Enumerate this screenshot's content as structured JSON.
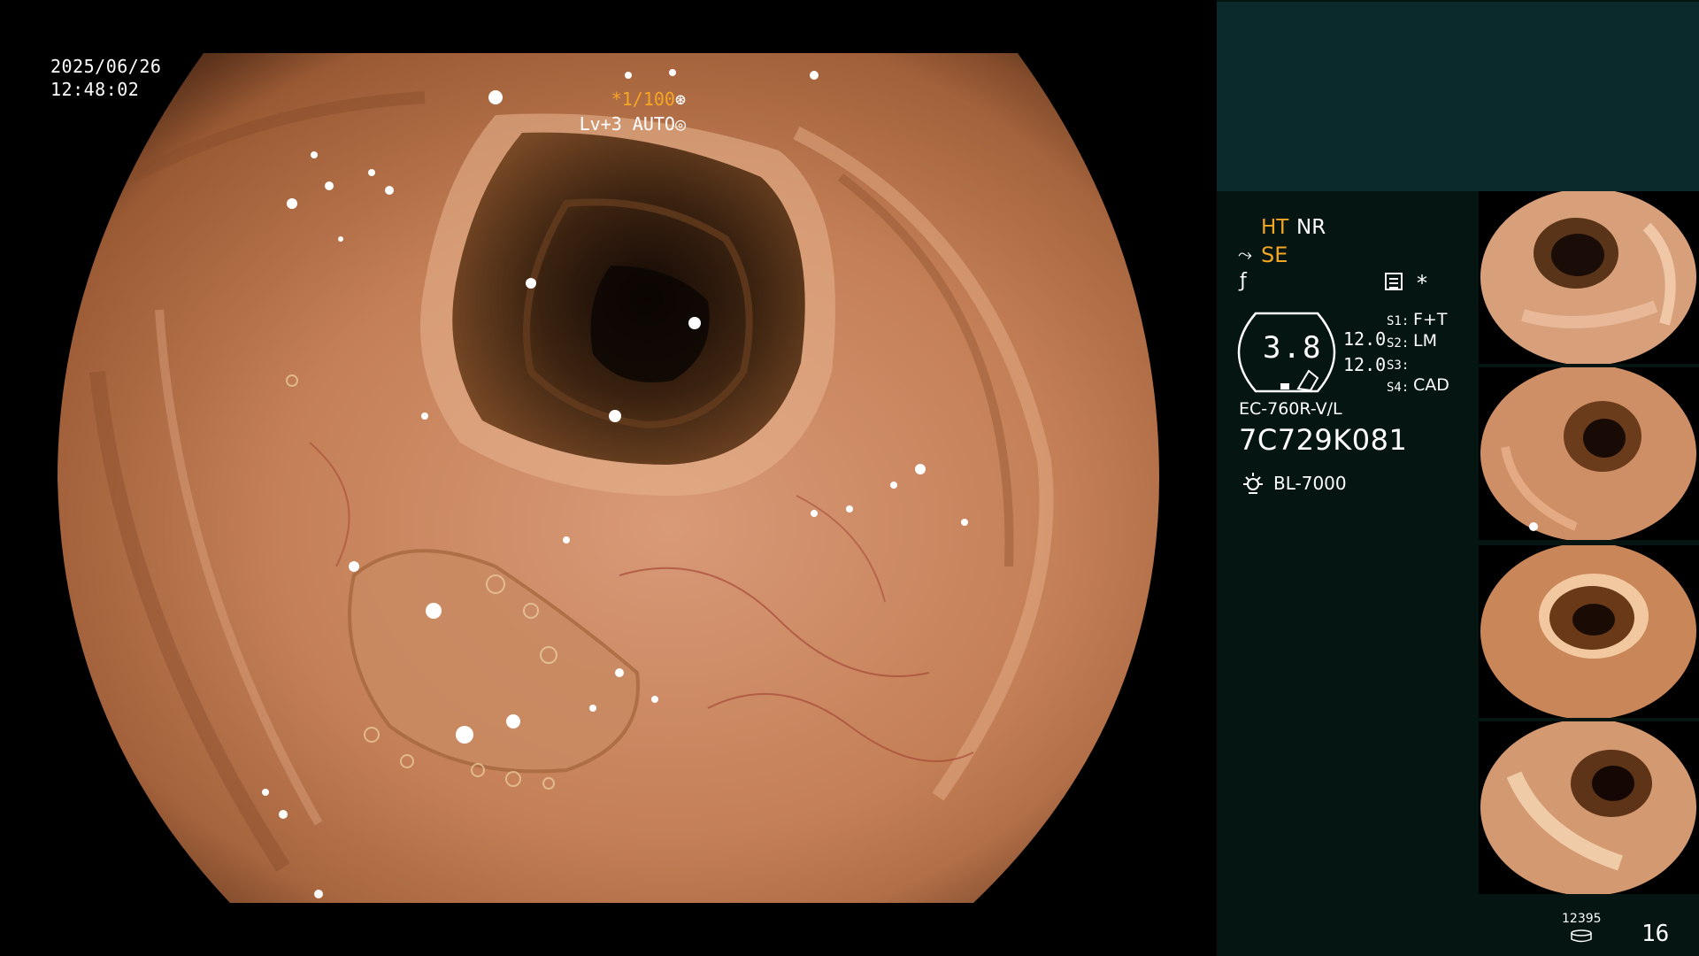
{
  "overlay": {
    "date": "2025/06/26",
    "time": "12:48:02",
    "shutter_speed": "*1/100",
    "shutter_icon": "aperture-icon",
    "level_mode": "Lv+3 AUTO",
    "level_icon": "iris-icon"
  },
  "panel": {
    "ht_label": "HT",
    "nr_label": "NR",
    "se_icon": "scope-connector-icon",
    "se_label": "SE",
    "f_icon": "frequency-icon",
    "memo_icon": "memo-icon",
    "asterisk": "*",
    "zoom_value": "3.8",
    "value_1": "12.0",
    "value_2": "12.0",
    "switches": [
      {
        "label": "S1:",
        "value": "F+T"
      },
      {
        "label": "S2:",
        "value": "LM"
      },
      {
        "label": "S3:",
        "value": ""
      },
      {
        "label": "S4:",
        "value": "CAD"
      }
    ],
    "scope_model": "EC-760R-V/L",
    "scope_serial": "7C729K081",
    "light_icon": "lamp-icon",
    "light_source": "BL-7000"
  },
  "thumbnails": [
    {
      "name": "captured-image-1"
    },
    {
      "name": "captured-image-2"
    },
    {
      "name": "captured-image-3"
    },
    {
      "name": "captured-image-4"
    }
  ],
  "footer": {
    "image_count": "12395",
    "storage_icon": "storage-icon",
    "page_number": "16"
  },
  "colors": {
    "accent_orange": "#f5a623",
    "panel_background": "#041512",
    "panel_top": "#0b2a2b"
  }
}
